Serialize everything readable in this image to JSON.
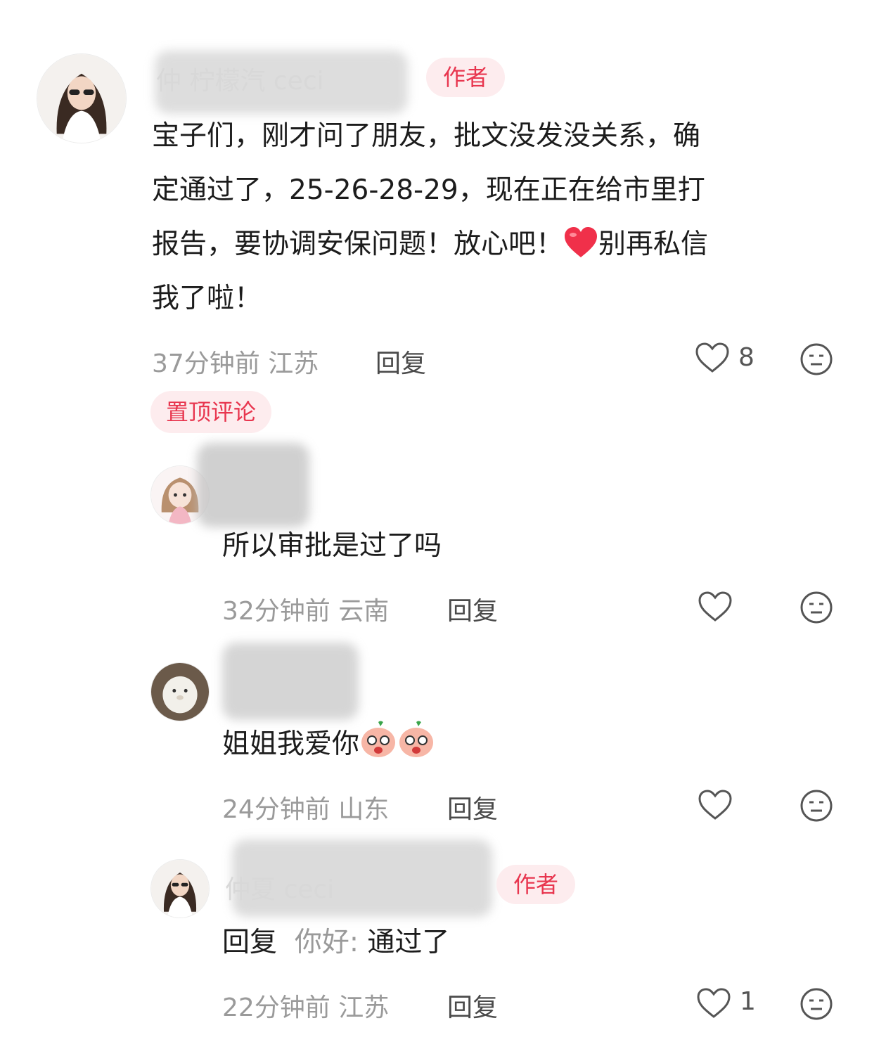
{
  "colors": {
    "accent": "#e8364f",
    "badge_bg": "#fdecee",
    "meta": "#9a9a9a"
  },
  "icons": {
    "like": "heart-icon",
    "react": "meh-face-icon",
    "heart_emoji": "red-heart-emoji",
    "peach_emoji": "peach-face-emoji"
  },
  "comments": [
    {
      "username": "仲 柠檬汽 ceci",
      "badge": "作者",
      "lines": [
        "宝子们，刚才问了朋友，批文没发没关系，确",
        "定通过了，25-26-28-29，现在正在给市里打",
        "报告，要协调安保问题！放心吧！",
        "别再私信",
        "我了啦！"
      ],
      "time": "37分钟前",
      "region": "江苏",
      "reply_label": "回复",
      "likes": "8",
      "pinned_label": "置顶评论"
    },
    {
      "text": "所以审批是过了吗",
      "time": "32分钟前",
      "region": "云南",
      "reply_label": "回复"
    },
    {
      "text": "姐姐我爱你",
      "time": "24分钟前",
      "region": "山东",
      "reply_label": "回复"
    },
    {
      "username": "仲夏 ceci",
      "badge": "作者",
      "reply_prefix": "回复",
      "reply_target": "你好:",
      "text": "通过了",
      "time": "22分钟前",
      "region": "江苏",
      "reply_label": "回复",
      "likes": "1"
    }
  ]
}
